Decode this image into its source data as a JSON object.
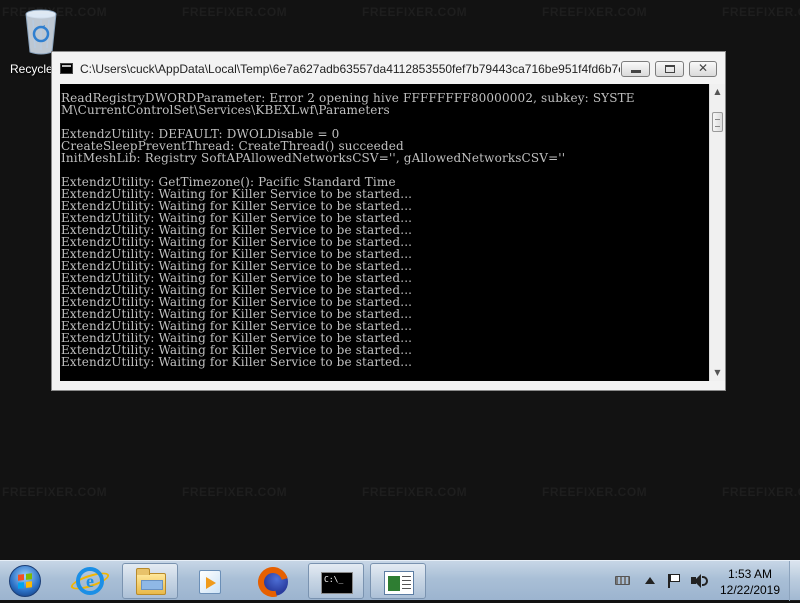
{
  "watermark": {
    "text": "FREEFIXER.COM"
  },
  "desktop": {
    "recycle_bin_label": "Recycle"
  },
  "console_window": {
    "title": "C:\\Users\\cuck\\AppData\\Local\\Temp\\6e7a627adb63557da4112853550fef7b79443ca716be951f4fd6b7e...",
    "lines": [
      "ReadRegistryDWORDParameter: Error 2 opening hive FFFFFFFF80000002, subkey: SYSTE",
      "M\\CurrentControlSet\\Services\\KBEXLwf\\Parameters",
      "",
      "ExtendzUtility: DEFAULT: DWOLDisable = 0",
      "CreateSleepPreventThread: CreateThread() succeeded",
      "InitMeshLib: Registry SoftAPAllowedNetworksCSV='', gAllowedNetworksCSV=''",
      "",
      "ExtendzUtility: GetTimezone(): Pacific Standard Time",
      "ExtendzUtility: Waiting for Killer Service to be started...",
      "ExtendzUtility: Waiting for Killer Service to be started...",
      "ExtendzUtility: Waiting for Killer Service to be started...",
      "ExtendzUtility: Waiting for Killer Service to be started...",
      "ExtendzUtility: Waiting for Killer Service to be started...",
      "ExtendzUtility: Waiting for Killer Service to be started...",
      "ExtendzUtility: Waiting for Killer Service to be started...",
      "ExtendzUtility: Waiting for Killer Service to be started...",
      "ExtendzUtility: Waiting for Killer Service to be started...",
      "ExtendzUtility: Waiting for Killer Service to be started...",
      "ExtendzUtility: Waiting for Killer Service to be started...",
      "ExtendzUtility: Waiting for Killer Service to be started...",
      "ExtendzUtility: Waiting for Killer Service to be started...",
      "ExtendzUtility: Waiting for Killer Service to be started...",
      "ExtendzUtility: Waiting for Killer Service to be started..."
    ]
  },
  "taskbar": {
    "cmd_icon_text": "C:\\_",
    "pinned": [
      "start-button",
      "internet-explorer",
      "windows-explorer",
      "media-player",
      "firefox",
      "command-prompt",
      "app-window"
    ],
    "active": [
      "windows-explorer",
      "command-prompt",
      "app-window"
    ],
    "clock": {
      "time": "1:53 AM",
      "date": "12/22/2019"
    }
  },
  "colors": {
    "desktop_bg": "#121212",
    "console_bg": "#000000",
    "console_text": "#c0c0c0",
    "taskbar": "#b7cadf"
  }
}
